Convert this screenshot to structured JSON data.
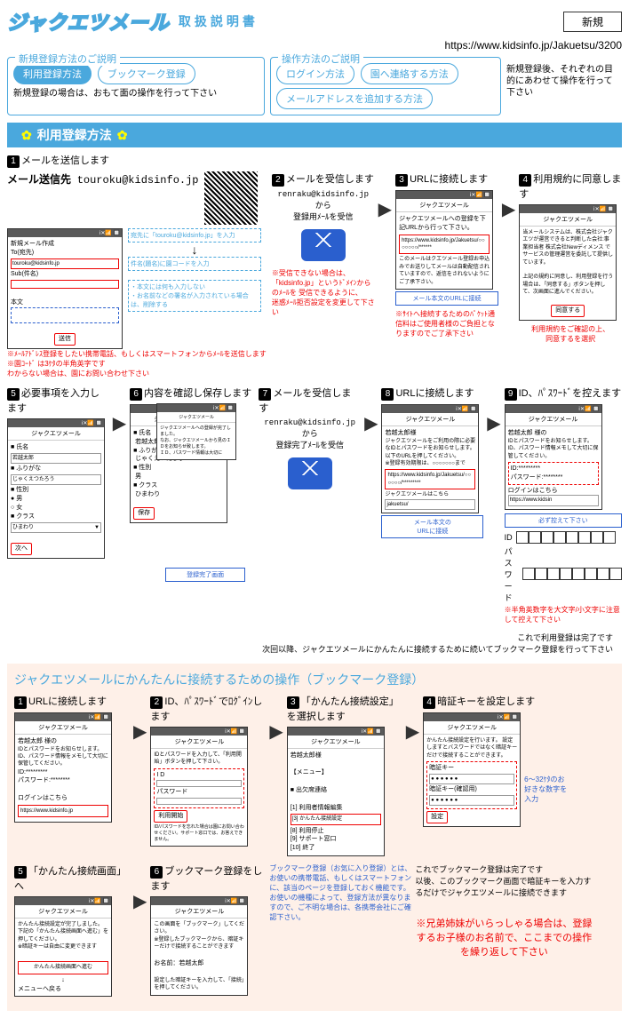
{
  "header": {
    "logo": "ジャクエツメール",
    "subtitle": "取扱説明書",
    "badge": "新規",
    "url": "https://www.kidsinfo.jp/Jakuetsu/3200"
  },
  "sections": {
    "s1": {
      "label": "新規登録方法のご説明",
      "pills": [
        "利用登録方法",
        "ブックマーク登録"
      ],
      "note": "新規登録の場合は、おもて面の操作を行って下さい"
    },
    "s2": {
      "label": "操作方法のご説明",
      "pills": [
        "ログイン方法",
        "園へ連絡する方法",
        "メールアドレスを追加する方法"
      ],
      "note": "新規登録後、それぞれの目的にあわせて操作を行って下さい"
    }
  },
  "bar1": "利用登録方法",
  "step1": {
    "title": "メールを送信します",
    "mail_label": "メール送信先",
    "mail_addr": "touroku@kidsinfo.jp",
    "phone": {
      "create": "新規メール作成",
      "to": "To(宛先)",
      "addr": "touroku@kidsinfo.jp",
      "sub": "Sub(件名)",
      "body": "本文",
      "send": "送信"
    },
    "tip1": "宛先に「touroku@kidsinfo.jp」を入力",
    "tip2": "件名(題名)に園コードを入力",
    "tip3": "・本文には何も入力しない\n・お名前などの署名が入力されている場合は、削除する",
    "warn1": "※ﾒｰﾙｱﾄﾞﾚｽ登録をしたい携帯電話、もしくはスマートフォンからﾒｰﾙを送信します",
    "warn2": "※園ｺｰﾄﾞ は3ｹﾀの半角英字です\nわからない場合は、園にお問い合わせ下さい"
  },
  "step2": {
    "title": "メールを受信します",
    "from": "renraku@kidsinfo.jp",
    "note": "から\n登録用ﾒｰﾙを受信",
    "warn": "※受信できない場合は、\n「kidsinfo.jp」というﾄﾞﾒｲﾝからのﾒｰﾙを 受信できるように、\n迷惑ﾒｰﾙ拒否設定を変更して下さい"
  },
  "step3": {
    "title": "URLに接続します",
    "phone_title": "ジャクエツメール",
    "text1": "ジャクエツメールへの登録を下記URLから行って下さい。",
    "url": "https://www.kidsinfo.jp/Jakuetsu/○○○○○○○/******",
    "text2": "このメールはクエツメール登録お申込みでお送りしてメールは自動配信されていますので、返信をされないようにご了承下さい。",
    "box": "メール本文のURLに接続",
    "warn": "※ｻｲﾄへ接続するためのﾊﾟｹｯﾄ通信料はご使用者様のご負担となりますのでご了承下さい"
  },
  "step4": {
    "title": "利用規約に同意します",
    "phone_title": "ジャクエツメール",
    "text": "当メールシステムは、株式会社ジャクエツが運営できると判断した会社:事業担当者 株式会社Newディメンス でサービスの管理運営を委託して提供しています。\n\n上記の規約に同意し、利用登録を行う場合は、「同意する」ボタンを押して、次画面に進んでください。",
    "btn": "同意する",
    "note": "利用規約をご確認の上、\n同意するを選択"
  },
  "step5": {
    "title": "必要事項を入力します",
    "phone_title": "ジャクエツメール",
    "f_name": "氏名",
    "v_name": "若越太郎",
    "f_kana": "ふりがな",
    "v_kana": "じゃくえつたろう",
    "f_sex": "性別",
    "v_m": "男",
    "v_f": "女",
    "f_class": "クラス",
    "v_class": "ひまわり",
    "btn": "次へ"
  },
  "step6": {
    "title": "内容を確認し保存します",
    "phone_title": "ジャクエツメール",
    "btn": "保存",
    "overlay_title": "ジャクエツメール",
    "overlay_text": "ジャクエツメールへの登録が完了しました。\nなお、ジャクエツメールから見のＩＤをお知らせ致します。\nＩＤ、パスワード情報は大切に",
    "caption": "登録完了画面"
  },
  "step7": {
    "title": "メールを受信します",
    "from": "renraku@kidsinfo.jp",
    "note": "から\n登録完了ﾒｰﾙを受信"
  },
  "step8": {
    "title": "URLに接続します",
    "phone_title": "ジャクエツメール",
    "name": "若越太郎様",
    "text1": "ジャクエツメールをご利用の際に必要なIDとパスワードをお知らせします。",
    "text2": "以下のURLを押してください。\n※登録有効期限は、○○○○○○○まで",
    "url": "https://www.kidsinfo.jp/Jakuetsu/○○○○○○/*********",
    "text3": "ジャクエツメールはこちら",
    "url2": "jakuetsu/",
    "box": "メール本文の\nURLに接続"
  },
  "step9": {
    "title": "ID、ﾊﾟｽﾜｰﾄﾞを控えます",
    "phone_title": "ジャクエツメール",
    "name": "若越太郎 様の",
    "text": "IDとパスワードをお知らせします。\nID、パスワード情報メモして大切に保管してください。",
    "id_label": "ID:*********",
    "pw_label": "パスワード:********",
    "login": "ログインはこちら",
    "login_url": "https://www.kidsin",
    "box": "必ず控えて下さい",
    "id_t": "ID",
    "pw_t": "パスワード",
    "warn": "※半角英数字を大文字/小文字に注意して控えて下さい",
    "done": "これで利用登録は完了です\n次回以降、ジャクエツメールにかんたんに接続するために続いてブックマーク登録を行って下さい"
  },
  "pink": {
    "title": "ジャクエツメールにかんたんに接続するための操作（ブックマーク登録）",
    "b1": {
      "title": "URLに接続します",
      "phone_title": "ジャクエツメール",
      "name": "若越太郎 様の",
      "text": "IDとパスワードをお知らせします。\nID、パスワード情報をメモして大切に保管してください。",
      "id": "ID:*********",
      "pw": "パスワード:********",
      "login": "ログインはこちら",
      "url": "https://www.kidsinfo.jp"
    },
    "b2": {
      "title": "ID、ﾊﾟｽﾜｰﾄﾞでﾛｸﾞｲﾝします",
      "phone_title": "ジャクエツメール",
      "text": "IDとパスワードを入力して、「利用開始」ボタンを押して下さい。",
      "id_l": "I D",
      "pw_l": "パスワード",
      "btn": "利用開始",
      "note": "ID/パスワードを忘れた場合は園にお問い合わせください。サポート窓口では、お答えできません。"
    },
    "b3": {
      "title": "「かんたん接続設定」を選択します",
      "phone_title": "ジャクエツメール",
      "name": "若越太郎様",
      "menu_l": "【メニュー】",
      "items": [
        "■ 出欠席連絡",
        "[1] 利用者情報編集",
        "[3] かんたん接続設定",
        "[8] 利用停止",
        "[9] サポート窓口",
        "[10] 終了"
      ]
    },
    "b4": {
      "title": "暗証キーを設定します",
      "phone_title": "ジャクエツメール",
      "text": "かんたん接続設定を行います。\n設定しますとバスワードではなく暗証キーだけで接続することができます。",
      "k1": "暗証キー",
      "k2": "暗証キー(確認用)",
      "btn": "設定",
      "note": "6～32ｹﾀのお好きな数字を入力"
    },
    "b5": {
      "title": "「かんたん接続画面」へ",
      "phone_title": "ジャクエツメール",
      "text": "かんたん接続設定が完了しました。\n下記の「かんたん接続画面へ進む」を押してください。\n※暗証キーは自由に変更できます",
      "btn": "かんたん接続画面へ進む",
      "arrow": "↓",
      "menu": "メニューへ戻る"
    },
    "b6": {
      "title": "ブックマーク登録をします",
      "phone_title": "ジャクエツメール",
      "text": "この画面を「ブックマーク」してください。\n※登録したブックマークから、暗証キーだけで接続することができます",
      "name_l": "お名前：若越太郎",
      "note": "設定した暗証キーを入力して、「接続」を押してください。"
    },
    "info": "ブックマーク登録（お気に入り登録）とは、お使いの携帯電話、もしくはスマートフォンに、該当のページを登録しておく機能です。お使いの機種によって、登録方法が異なりますので、ご不明な場合は、各携帯会社にご確認下さい。",
    "done": "これでブックマーク登録は完了です\n以後、このブックマーク画面で暗証キーを入力するだけでジャクエツメールに接続できます",
    "siblings": "※兄弟姉妹がいらっしゃる場合は、登録するお子様のお名前で、ここまでの操作を繰り返して下さい"
  }
}
